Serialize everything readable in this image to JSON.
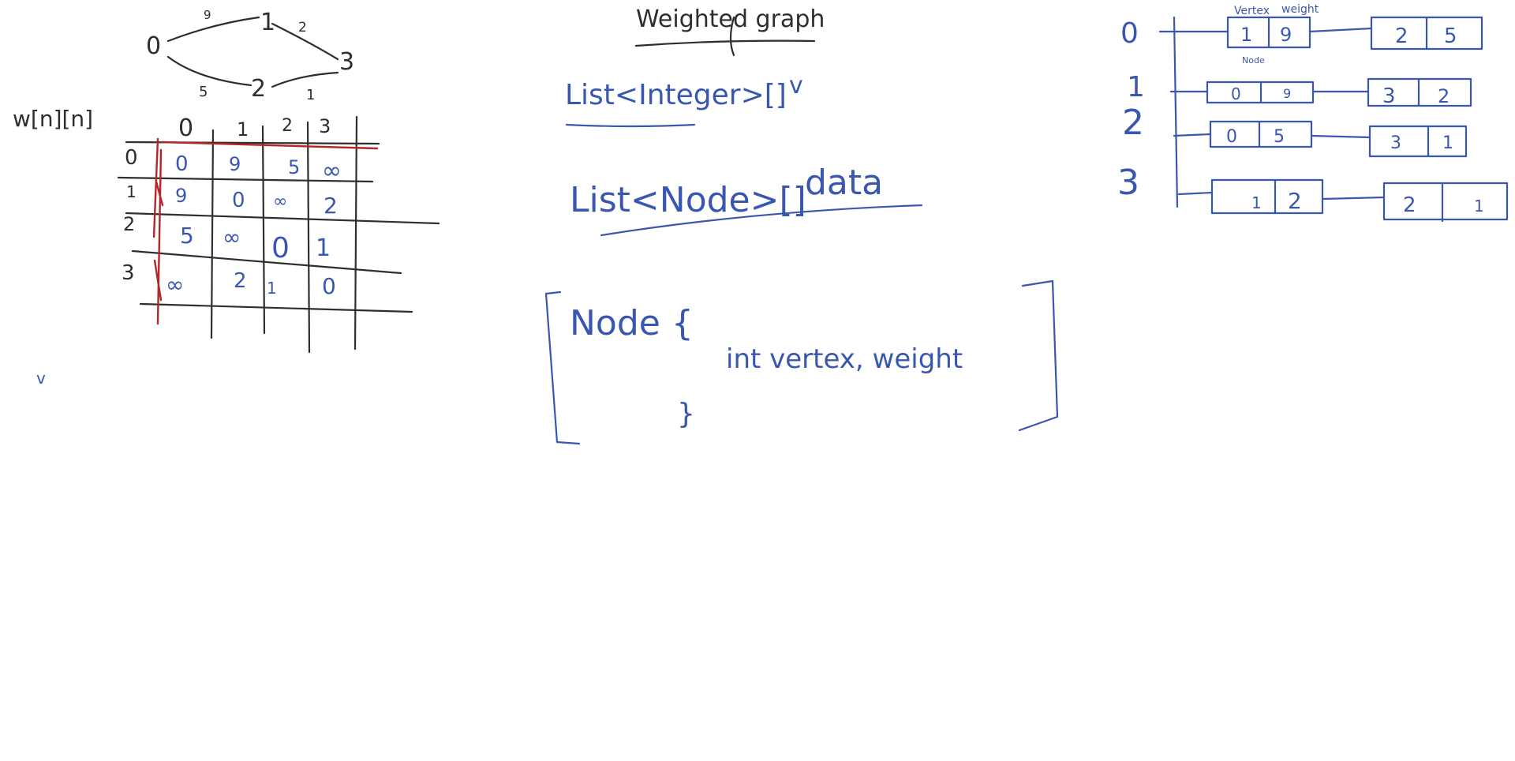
{
  "colors": {
    "black_ink": "#2c2f2c",
    "blue_ink": "#3a57b0",
    "red_ink": "#b3262a",
    "background": "#ffffff"
  },
  "graph": {
    "nodes": [
      "0",
      "1",
      "2",
      "3"
    ],
    "edge_weights": {
      "e01": "9",
      "e13": "2",
      "e02": "5",
      "e23": "1"
    }
  },
  "matrix": {
    "label": "w[n][n]",
    "col_headers": [
      "0",
      "1",
      "2",
      "3"
    ],
    "row_headers": [
      "0",
      "1",
      "2",
      "3"
    ],
    "cells": [
      [
        "0",
        "9",
        "5",
        "∞"
      ],
      [
        "9",
        "0",
        "∞",
        "2"
      ],
      [
        "5",
        "∞",
        "0",
        "1"
      ],
      [
        "∞",
        "2",
        "1",
        "0"
      ]
    ]
  },
  "stray_mark": "v",
  "notes": {
    "title": "Weighted graph",
    "line1": "List<Integer>[]",
    "line1_suffix": "v",
    "line2": "List<Node>[]",
    "line2_suffix": "data",
    "node_def": "Node {",
    "node_fields": "int vertex, weight",
    "node_close": "}"
  },
  "adjacency": {
    "header_vertex": "Vertex",
    "header_weight": "weight",
    "node_caption": "Node",
    "rows": [
      {
        "index": "0",
        "nodes": [
          [
            "1",
            "9"
          ],
          [
            "2",
            "5"
          ]
        ]
      },
      {
        "index": "1",
        "nodes": [
          [
            "0",
            "9"
          ],
          [
            "3",
            "2"
          ]
        ]
      },
      {
        "index": "2",
        "nodes": [
          [
            "0",
            "5"
          ],
          [
            "3",
            "1"
          ]
        ]
      },
      {
        "index": "3",
        "nodes": [
          [
            "1",
            "2"
          ],
          [
            "2",
            "1"
          ]
        ]
      }
    ]
  }
}
